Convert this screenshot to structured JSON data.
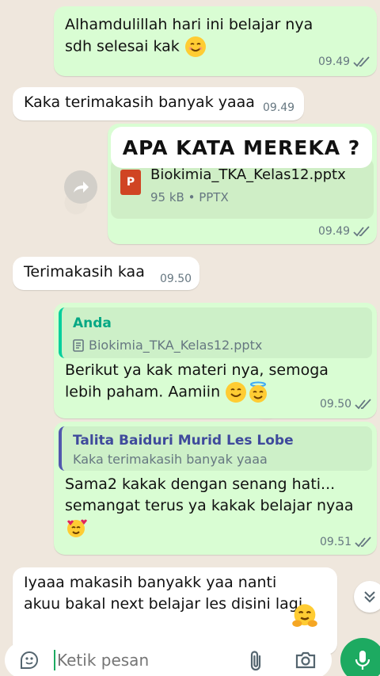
{
  "messages": {
    "m1": {
      "text": "Alhamdulillah hari ini belajar nya sdh selesai kak",
      "time": "09.49",
      "emoji": "smiling-face-emoji"
    },
    "m2": {
      "text": "Kaka terimakasih banyak yaaa",
      "time": "09.49"
    },
    "m3": {
      "overlay_caption": "APA KATA MEREKA  ?",
      "file_name": "Biokimia_TKA_Kelas12.pptx",
      "file_meta": "95 kB • PPTX",
      "time": "09.49"
    },
    "m4": {
      "text": "Terimakasih kaa",
      "time": "09.50"
    },
    "m5": {
      "quote_name": "Anda",
      "quote_file": "Biokimia_TKA_Kelas12.pptx",
      "text": "Berikut ya kak materi nya, semoga lebih paham. Aamiin",
      "time": "09.50",
      "emoji": [
        "smiling-face-emoji",
        "halo-face-emoji"
      ]
    },
    "m6": {
      "quote_name": "Talita Baiduri Murid Les Lobe",
      "quote_text": "Kaka terimakasih banyak yaaa",
      "text": "Sama2 kakak dengan senang hati... semangat terus ya kakak belajar nyaa",
      "time": "09.51",
      "emoji": "smiling-hearts-emoji"
    },
    "m7": {
      "text": "Iyaaa makasih banyakk yaa nanti akuu bakal next belajar les disini lagi",
      "emoji": "hugging-face-emoji"
    }
  },
  "composer": {
    "placeholder": "Ketik pesan"
  },
  "colors": {
    "outgoing": "#d9fdd3",
    "incoming": "#ffffff",
    "accent": "#1daa61",
    "read_ticks": "#667781"
  }
}
